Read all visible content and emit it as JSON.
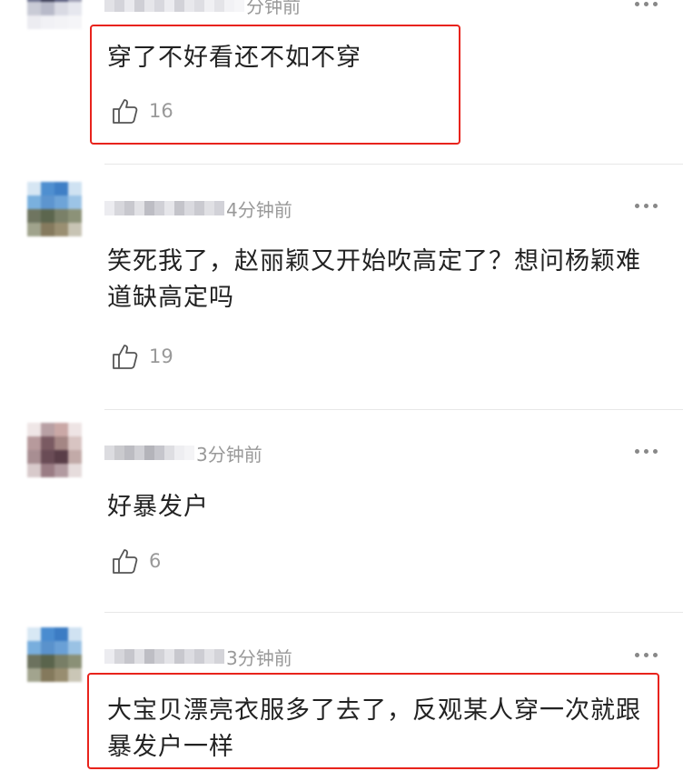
{
  "comments": [
    {
      "time": "分钟前",
      "text": "穿了不好看还不如不穿",
      "likes": "16"
    },
    {
      "time": "4分钟前",
      "text": "笑死我了，赵丽颖又开始吹高定了？想问杨颖难道缺高定吗",
      "likes": "19"
    },
    {
      "time": "3分钟前",
      "text": "好暴发户",
      "likes": "6"
    },
    {
      "time": "3分钟前",
      "text": "大宝贝漂亮衣服多了去了，反观某人穿一次就跟暴发户一样",
      "likes": ""
    }
  ],
  "icons": {
    "like": "thumbs-up-icon",
    "more": "more-dots-icon"
  },
  "colors": {
    "highlight": "#e8231c",
    "meta_text": "#999999",
    "body_text": "#222222"
  }
}
